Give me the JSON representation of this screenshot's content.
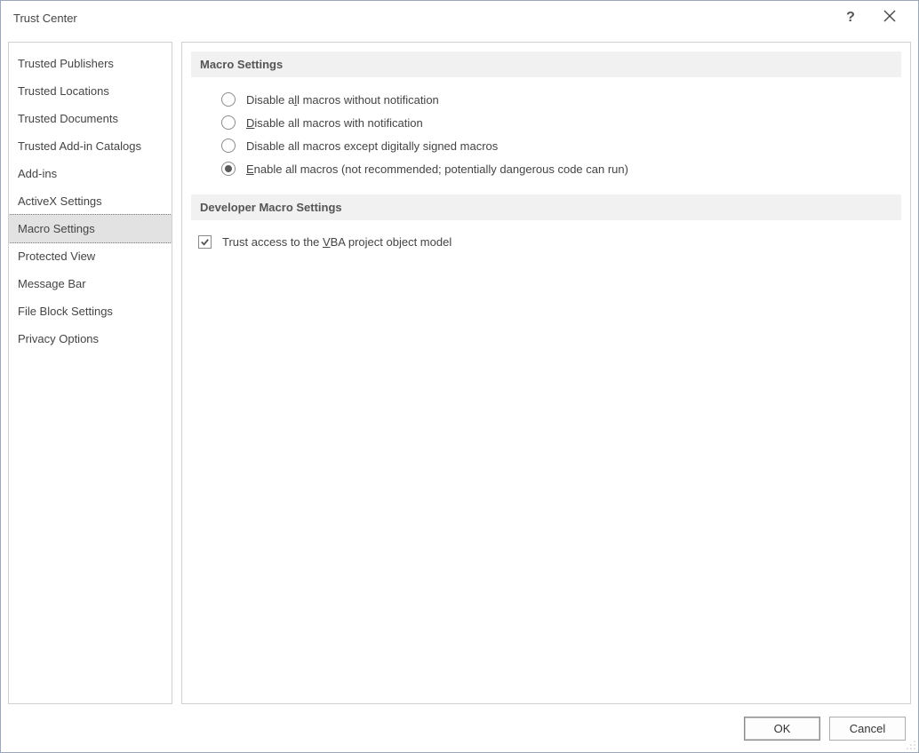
{
  "window": {
    "title": "Trust Center"
  },
  "sidebar": {
    "items": [
      {
        "label": "Trusted Publishers"
      },
      {
        "label": "Trusted Locations"
      },
      {
        "label": "Trusted Documents"
      },
      {
        "label": "Trusted Add-in Catalogs"
      },
      {
        "label": "Add-ins"
      },
      {
        "label": "ActiveX Settings"
      },
      {
        "label": "Macro Settings",
        "selected": true
      },
      {
        "label": "Protected View"
      },
      {
        "label": "Message Bar"
      },
      {
        "label": "File Block Settings"
      },
      {
        "label": "Privacy Options"
      }
    ]
  },
  "main": {
    "sections": {
      "macro": {
        "header": "Macro Settings",
        "options": [
          {
            "label_pre": "Disable a",
            "underline": "l",
            "label_post": "l macros without notification",
            "checked": false
          },
          {
            "label_pre": "",
            "underline": "D",
            "label_post": "isable all macros with notification",
            "checked": false
          },
          {
            "label_pre": "Disable all macros except di",
            "underline": "g",
            "label_post": "itally signed macros",
            "checked": false
          },
          {
            "label_pre": "",
            "underline": "E",
            "label_post": "nable all macros (not recommended; potentially dangerous code can run)",
            "checked": true
          }
        ]
      },
      "developer": {
        "header": "Developer Macro Settings",
        "options": [
          {
            "label_pre": "Trust access to the ",
            "underline": "V",
            "label_post": "BA project object model",
            "checked": true
          }
        ]
      }
    }
  },
  "footer": {
    "ok": "OK",
    "cancel": "Cancel"
  }
}
